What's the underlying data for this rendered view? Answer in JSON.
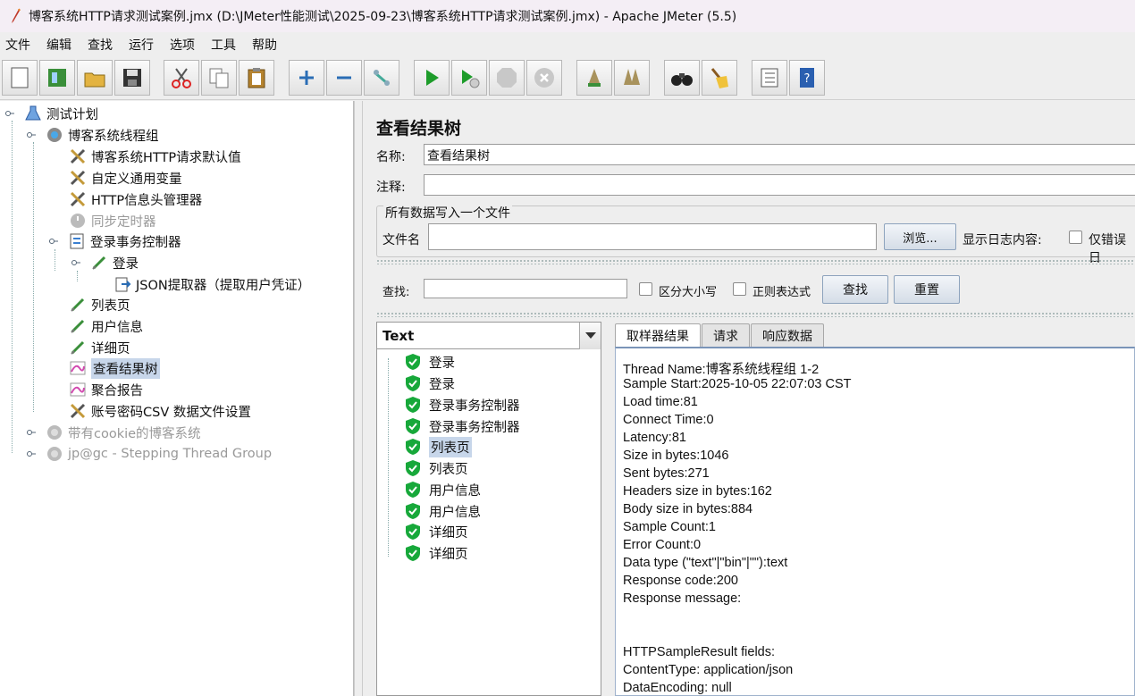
{
  "window": {
    "title": "博客系统HTTP请求测试案例.jmx (D:\\JMeter性能测试\\2025-09-23\\博客系统HTTP请求测试案例.jmx) - Apache JMeter (5.5)"
  },
  "menu": [
    "文件",
    "编辑",
    "查找",
    "运行",
    "选项",
    "工具",
    "帮助"
  ],
  "toolbar": [
    "new-icon",
    "templates-icon",
    "open-icon",
    "save-icon",
    "cut-icon",
    "copy-icon",
    "paste-icon",
    "expand-icon",
    "collapse-icon",
    "toggle-icon",
    "start-icon",
    "start-no-pause-icon",
    "stop-icon",
    "shutdown-icon",
    "clear-icon",
    "clear-all-icon",
    "search-icon",
    "reset-search-icon",
    "function-helper-icon",
    "help-icon"
  ],
  "tree": [
    {
      "label": "测试计划"
    },
    {
      "label": "博客系统线程组"
    },
    {
      "label": "博客系统HTTP请求默认值"
    },
    {
      "label": "自定义通用变量"
    },
    {
      "label": "HTTP信息头管理器"
    },
    {
      "label": "同步定时器"
    },
    {
      "label": "登录事务控制器"
    },
    {
      "label": "登录"
    },
    {
      "label": "JSON提取器（提取用户凭证）"
    },
    {
      "label": "列表页"
    },
    {
      "label": "用户信息"
    },
    {
      "label": "详细页"
    },
    {
      "label": "查看结果树"
    },
    {
      "label": "聚合报告"
    },
    {
      "label": "账号密码CSV 数据文件设置"
    },
    {
      "label": "带有cookie的博客系统"
    },
    {
      "label": "jp@gc - Stepping Thread Group"
    }
  ],
  "panel": {
    "title": "查看结果树",
    "name_label": "名称:",
    "name_value": "查看结果树",
    "comment_label": "注释:",
    "comment_value": "",
    "file_group_title": "所有数据写入一个文件",
    "filename_label": "文件名",
    "filename_value": "",
    "browse_button": "浏览...",
    "log_label": "显示日志内容:",
    "errors_only_label": "仅错误日",
    "search_label": "查找:",
    "search_value": "",
    "case_label": "区分大小写",
    "regex_label": "正则表达式",
    "find_button": "查找",
    "reset_button": "重置"
  },
  "renderer": {
    "selected": "Text"
  },
  "results": [
    "登录",
    "登录",
    "登录事务控制器",
    "登录事务控制器",
    "列表页",
    "列表页",
    "用户信息",
    "用户信息",
    "详细页",
    "详细页"
  ],
  "tabs": [
    "取样器结果",
    "请求",
    "响应数据"
  ],
  "sampler_result": [
    "Thread Name:博客系统线程组 1-2",
    "Sample Start:2025-10-05 22:07:03 CST",
    "Load time:81",
    "Connect Time:0",
    "Latency:81",
    "Size in bytes:1046",
    "Sent bytes:271",
    "Headers size in bytes:162",
    "Body size in bytes:884",
    "Sample Count:1",
    "Error Count:0",
    "Data type (\"text\"|\"bin\"|\"\"):text",
    "Response code:200",
    "Response message:",
    "",
    "",
    "HTTPSampleResult fields:",
    "ContentType: application/json",
    "DataEncoding: null"
  ]
}
